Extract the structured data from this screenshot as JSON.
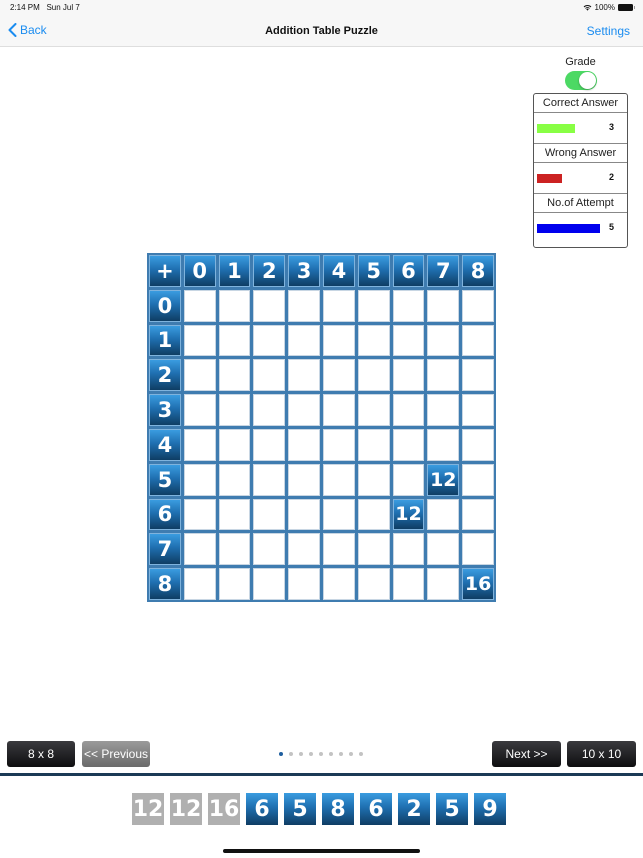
{
  "status_bar": {
    "time": "2:14 PM",
    "date": "Sun Jul 7",
    "battery": "100%"
  },
  "nav": {
    "back_label": "Back",
    "title": "Addition Table Puzzle",
    "settings_label": "Settings"
  },
  "grade": {
    "label": "Grade",
    "toggle_on": true,
    "stats": [
      {
        "label": "Correct Answer",
        "value": "3",
        "color": "#88ff44"
      },
      {
        "label": "Wrong Answer",
        "value": "2",
        "color": "#cc2222"
      },
      {
        "label": "No.of Attempt",
        "value": "5",
        "color": "#0000ee"
      }
    ]
  },
  "table": {
    "operator": "+",
    "columns": [
      "0",
      "1",
      "2",
      "3",
      "4",
      "5",
      "6",
      "7",
      "8"
    ],
    "rows": [
      "0",
      "1",
      "2",
      "3",
      "4",
      "5",
      "6",
      "7",
      "8"
    ],
    "filled": [
      {
        "row": 5,
        "col": 7,
        "value": "12"
      },
      {
        "row": 6,
        "col": 6,
        "value": "12"
      },
      {
        "row": 8,
        "col": 8,
        "value": "16"
      }
    ]
  },
  "controls": {
    "prev_size": "8 x 8",
    "previous": "<< Previous",
    "next": "Next >>",
    "next_size": "10 x 10",
    "page_count": 9,
    "current_page": 1
  },
  "answer_tiles": [
    {
      "value": "12",
      "used": true
    },
    {
      "value": "12",
      "used": true
    },
    {
      "value": "16",
      "used": true
    },
    {
      "value": "6",
      "used": false
    },
    {
      "value": "5",
      "used": false
    },
    {
      "value": "8",
      "used": false
    },
    {
      "value": "6",
      "used": false
    },
    {
      "value": "2",
      "used": false
    },
    {
      "value": "5",
      "used": false
    },
    {
      "value": "9",
      "used": false
    }
  ]
}
